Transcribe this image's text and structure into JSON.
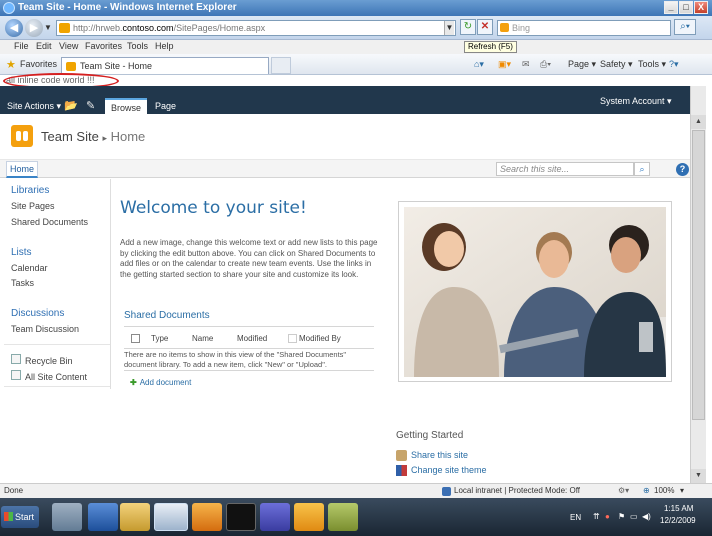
{
  "window": {
    "title": "Team Site - Home - Windows Internet Explorer",
    "controls": [
      "_",
      "□",
      "X"
    ]
  },
  "address": {
    "url_prefix": "http://hrweb.",
    "url_domain": "contoso.com",
    "url_suffix": "/SitePages/Home.aspx",
    "search_placeholder": "Bing",
    "tooltip": "Refresh (F5)"
  },
  "menu": [
    "File",
    "Edit",
    "View",
    "Favorites",
    "Tools",
    "Help"
  ],
  "favorites_bar": {
    "favorites_label": "Favorites",
    "tab_title": "Team Site - Home",
    "commands": [
      "Page ▾",
      "Safety ▾",
      "Tools ▾"
    ]
  },
  "inline_note": "all inline code world !!!",
  "ribbon": {
    "site_actions": "Site Actions ▾",
    "tabs": [
      "Browse",
      "Page"
    ],
    "user": "System Account ▾"
  },
  "site": {
    "title": "Team Site",
    "breadcrumb_sep": "▸",
    "current_page": "Home",
    "home_tab": "Home",
    "search_placeholder": "Search this site..."
  },
  "quick_launch": {
    "libraries": "Libraries",
    "site_pages": "Site Pages",
    "shared_documents": "Shared Documents",
    "lists": "Lists",
    "calendar": "Calendar",
    "tasks": "Tasks",
    "discussions": "Discussions",
    "team_discussion": "Team Discussion",
    "recycle_bin": "Recycle Bin",
    "all_site_content": "All Site Content"
  },
  "main": {
    "welcome": "Welcome to your site!",
    "intro": "Add a new image, change this welcome text or add new lists to this page by clicking the edit button above. You can click on Shared Documents to add files or on the calendar to create new team events. Use the links in the getting started section to share your site and customize its look.",
    "doc_title": "Shared Documents",
    "columns": {
      "type": "Type",
      "name": "Name",
      "modified": "Modified",
      "modified_by": "Modified By"
    },
    "no_items": "There are no items to show in this view of the \"Shared Documents\" document library. To add a new item, click \"New\" or \"Upload\".",
    "add_document": "Add document"
  },
  "getting_started": {
    "title": "Getting Started",
    "share": "Share this site",
    "theme": "Change site theme"
  },
  "status": {
    "left": "Done",
    "zone": "Local intranet | Protected Mode: Off",
    "zoom": "100%"
  },
  "taskbar": {
    "start": "Start",
    "lang": "EN",
    "time": "1:15 AM",
    "date": "12/2/2009"
  },
  "colors": {
    "accent": "#2b6ea5",
    "ribbon": "#21374c",
    "annotation": "#d52020",
    "logo": "#f4a00e"
  }
}
